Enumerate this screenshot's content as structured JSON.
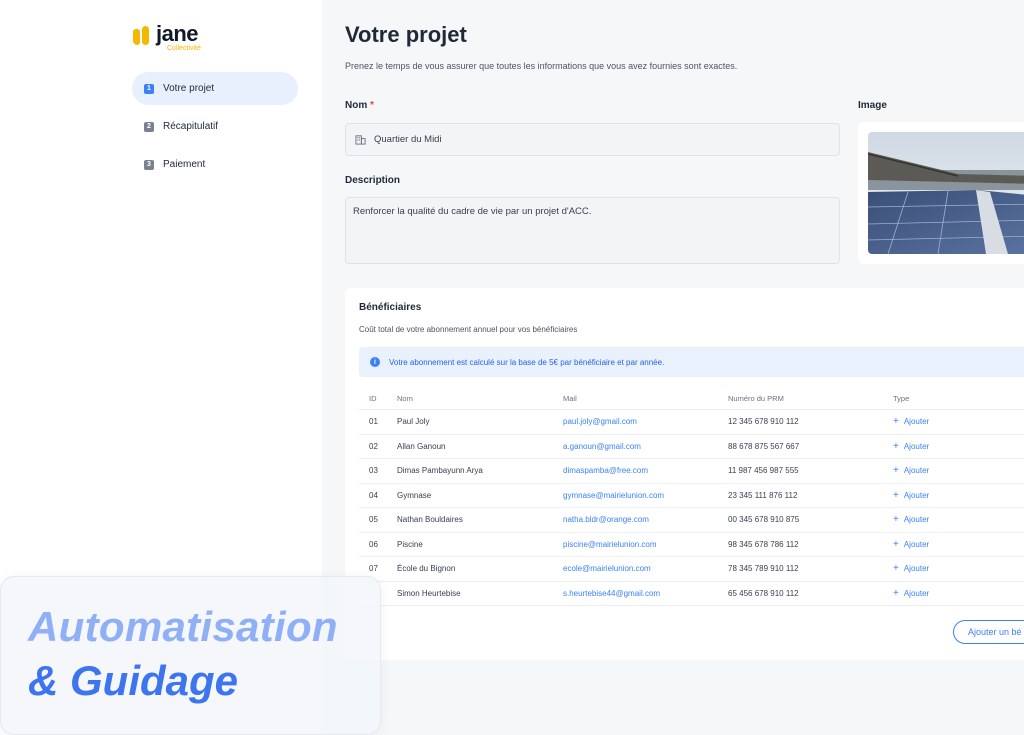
{
  "brand": {
    "name": "jane",
    "subtitle": "Collectivité",
    "accent": "#f5b800"
  },
  "nav": {
    "items": [
      {
        "num": "1",
        "label": "Votre projet",
        "active": true
      },
      {
        "num": "2",
        "label": "Récapitulatif",
        "active": false
      },
      {
        "num": "3",
        "label": "Paiement",
        "active": false
      }
    ]
  },
  "page": {
    "title": "Votre projet",
    "subtitle": "Prenez le temps de vous assurer que toutes les informations que vous avez fournies sont exactes."
  },
  "form": {
    "name_label": "Nom",
    "required_mark": "*",
    "name_value": "Quartier du Midi",
    "description_label": "Description",
    "description_value": "Renforcer la qualité du cadre de vie par un projet d'ACC.",
    "image_label": "Image"
  },
  "beneficiaries": {
    "title": "Bénéficiaires",
    "subtitle": "Coût total de votre abonnement annuel pour vos bénéficiaires",
    "info": "Votre abonnement est calculé sur la base de 5€ par bénéficiaire et par année.",
    "columns": {
      "id": "ID",
      "nom": "Nom",
      "mail": "Mail",
      "prm": "Numéro du PRM",
      "type": "Type"
    },
    "rows": [
      {
        "id": "01",
        "nom": "Paul Joly",
        "mail": "paul.joly@gmail.com",
        "prm": "12 345 678 910 112",
        "type": "Ajouter"
      },
      {
        "id": "02",
        "nom": "Allan Ganoun",
        "mail": "a.ganoun@gmail.com",
        "prm": "88 678 875 567 667",
        "type": "Ajouter"
      },
      {
        "id": "03",
        "nom": "Dimas Pambayunn Arya",
        "mail": "dimaspamba@free.com",
        "prm": "11 987 456 987 555",
        "type": "Ajouter"
      },
      {
        "id": "04",
        "nom": "Gymnase",
        "mail": "gymnase@mairielunion.com",
        "prm": "23 345 111 876 112",
        "type": "Ajouter"
      },
      {
        "id": "05",
        "nom": "Nathan Bouldaires",
        "mail": "natha.bldr@orange.com",
        "prm": "00 345 678 910 875",
        "type": "Ajouter"
      },
      {
        "id": "06",
        "nom": "Piscine",
        "mail": "piscine@mairielunion.com",
        "prm": "98 345 678 786 112",
        "type": "Ajouter"
      },
      {
        "id": "07",
        "nom": "École du Bignon",
        "mail": "ecole@mairielunion.com",
        "prm": "78 345 789 910 112",
        "type": "Ajouter"
      },
      {
        "id": "",
        "nom": "Simon Heurtebise",
        "mail": "s.heurtebise44@gmail.com",
        "prm": "65 456 678 910 112",
        "type": "Ajouter"
      }
    ],
    "add_button": "Ajouter un bé"
  },
  "overlay": {
    "line1": "Automatisation",
    "line2": "& Guidage"
  },
  "colors": {
    "primary": "#3b82f6",
    "overlay_light": "#8fb0f6",
    "overlay_dark": "#3d74f0"
  }
}
